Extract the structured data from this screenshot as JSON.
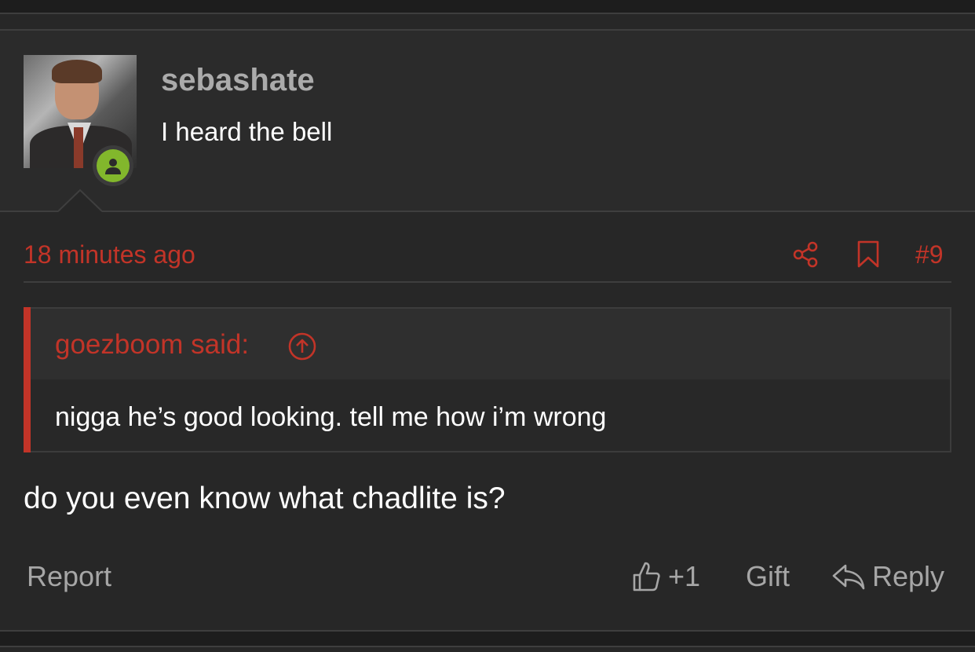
{
  "user": {
    "name": "sebashate",
    "title": "I heard the bell",
    "avatar_icon": "avatar-photo",
    "status_icon": "online-user-icon"
  },
  "post": {
    "time": "18 minutes ago",
    "number": "#9",
    "share_icon": "share-icon",
    "bookmark_icon": "bookmark-icon",
    "message": "do you even know what chadlite is?"
  },
  "quote": {
    "author": "goezboom said:",
    "text": "nigga he’s good looking. tell me how i’m wrong",
    "jump_icon": "arrow-up-circle-icon"
  },
  "actions": {
    "report": "Report",
    "like": "+1",
    "gift": "Gift",
    "reply": "Reply"
  },
  "colors": {
    "accent": "#c23428",
    "background": "#272727",
    "header_bg": "#2b2b2b",
    "online": "#82b72c",
    "muted_text": "#a6a6a6"
  }
}
